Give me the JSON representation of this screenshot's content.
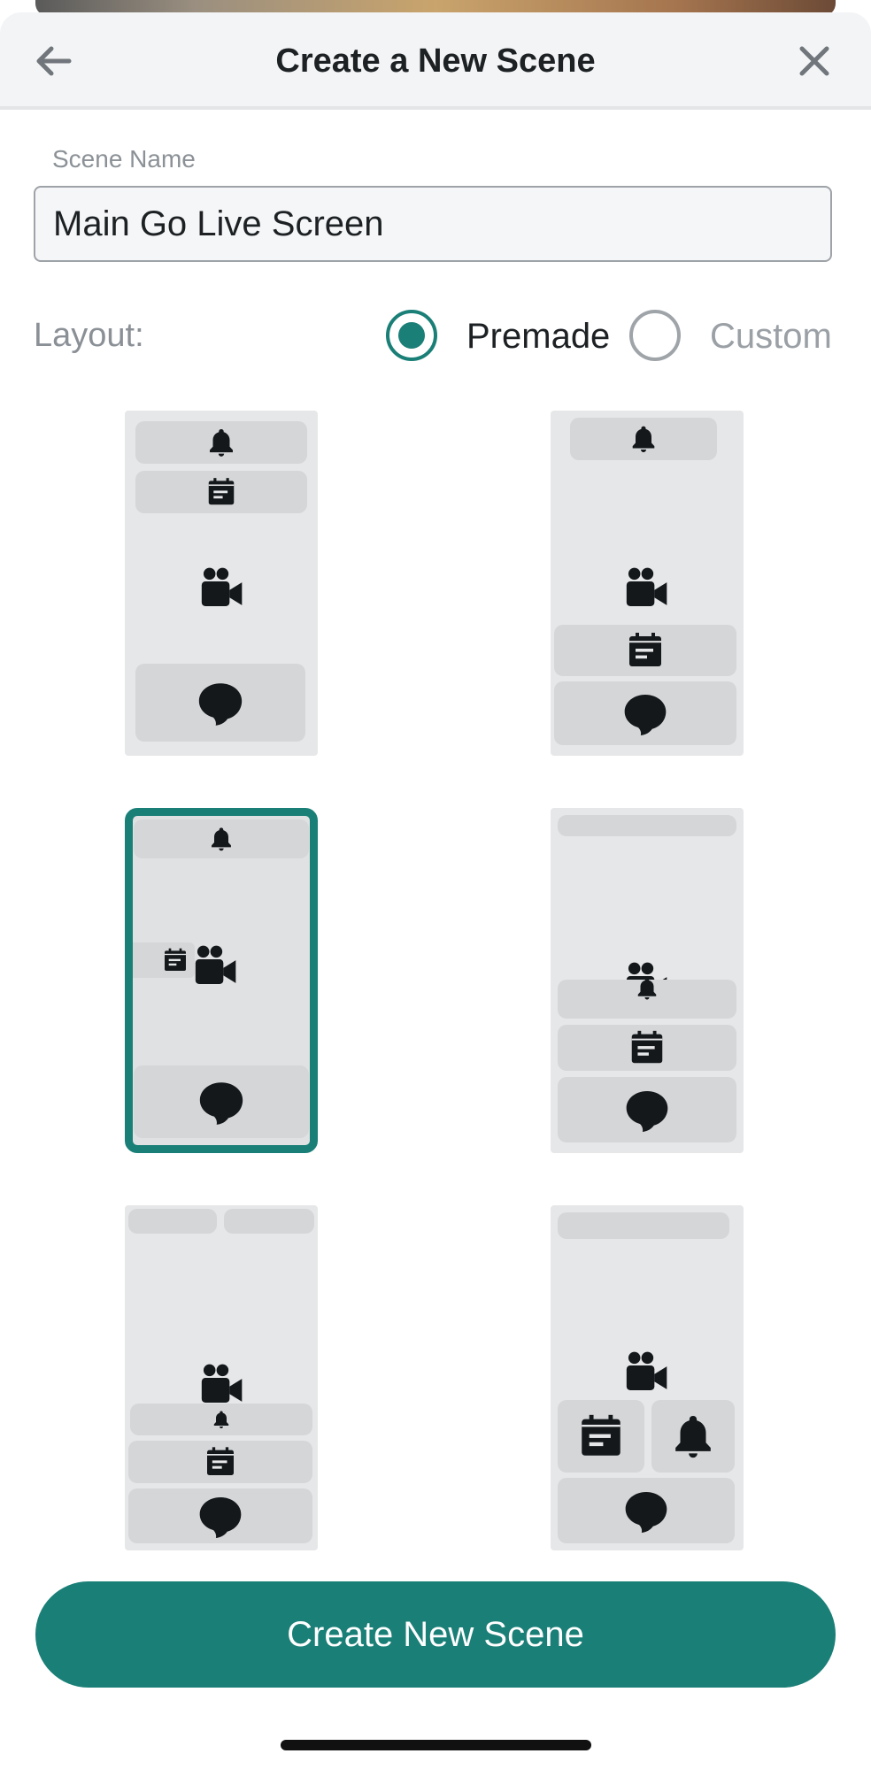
{
  "header": {
    "title": "Create a New Scene",
    "back_icon": "arrow-left-icon",
    "close_icon": "close-icon"
  },
  "scene_name": {
    "label": "Scene Name",
    "value": "Main Go Live Screen"
  },
  "layout": {
    "label": "Layout:",
    "options": [
      {
        "label": "Premade",
        "selected": true
      },
      {
        "label": "Custom",
        "selected": false
      }
    ]
  },
  "layouts": [
    {
      "selected": false,
      "widgets": [
        "bell-icon",
        "calendar-icon",
        "video-camera-icon",
        "chat-bubble-icon"
      ]
    },
    {
      "selected": false,
      "widgets": [
        "bell-icon",
        "video-camera-icon",
        "calendar-icon",
        "chat-bubble-icon"
      ]
    },
    {
      "selected": true,
      "widgets": [
        "bell-icon",
        "calendar-icon",
        "video-camera-icon",
        "chat-bubble-icon"
      ]
    },
    {
      "selected": false,
      "widgets": [
        "video-camera-icon",
        "bell-icon",
        "calendar-icon",
        "chat-bubble-icon"
      ]
    },
    {
      "selected": false,
      "widgets": [
        "video-camera-icon",
        "bell-icon",
        "calendar-icon",
        "chat-bubble-icon"
      ]
    },
    {
      "selected": false,
      "widgets": [
        "video-camera-icon",
        "calendar-icon",
        "bell-icon",
        "chat-bubble-icon"
      ]
    }
  ],
  "create_button": {
    "label": "Create New Scene"
  },
  "colors": {
    "accent": "#1a7f77",
    "card_bg": "#e6e7e8",
    "slot_bg": "#d5d6d8",
    "icon": "#14181b"
  }
}
